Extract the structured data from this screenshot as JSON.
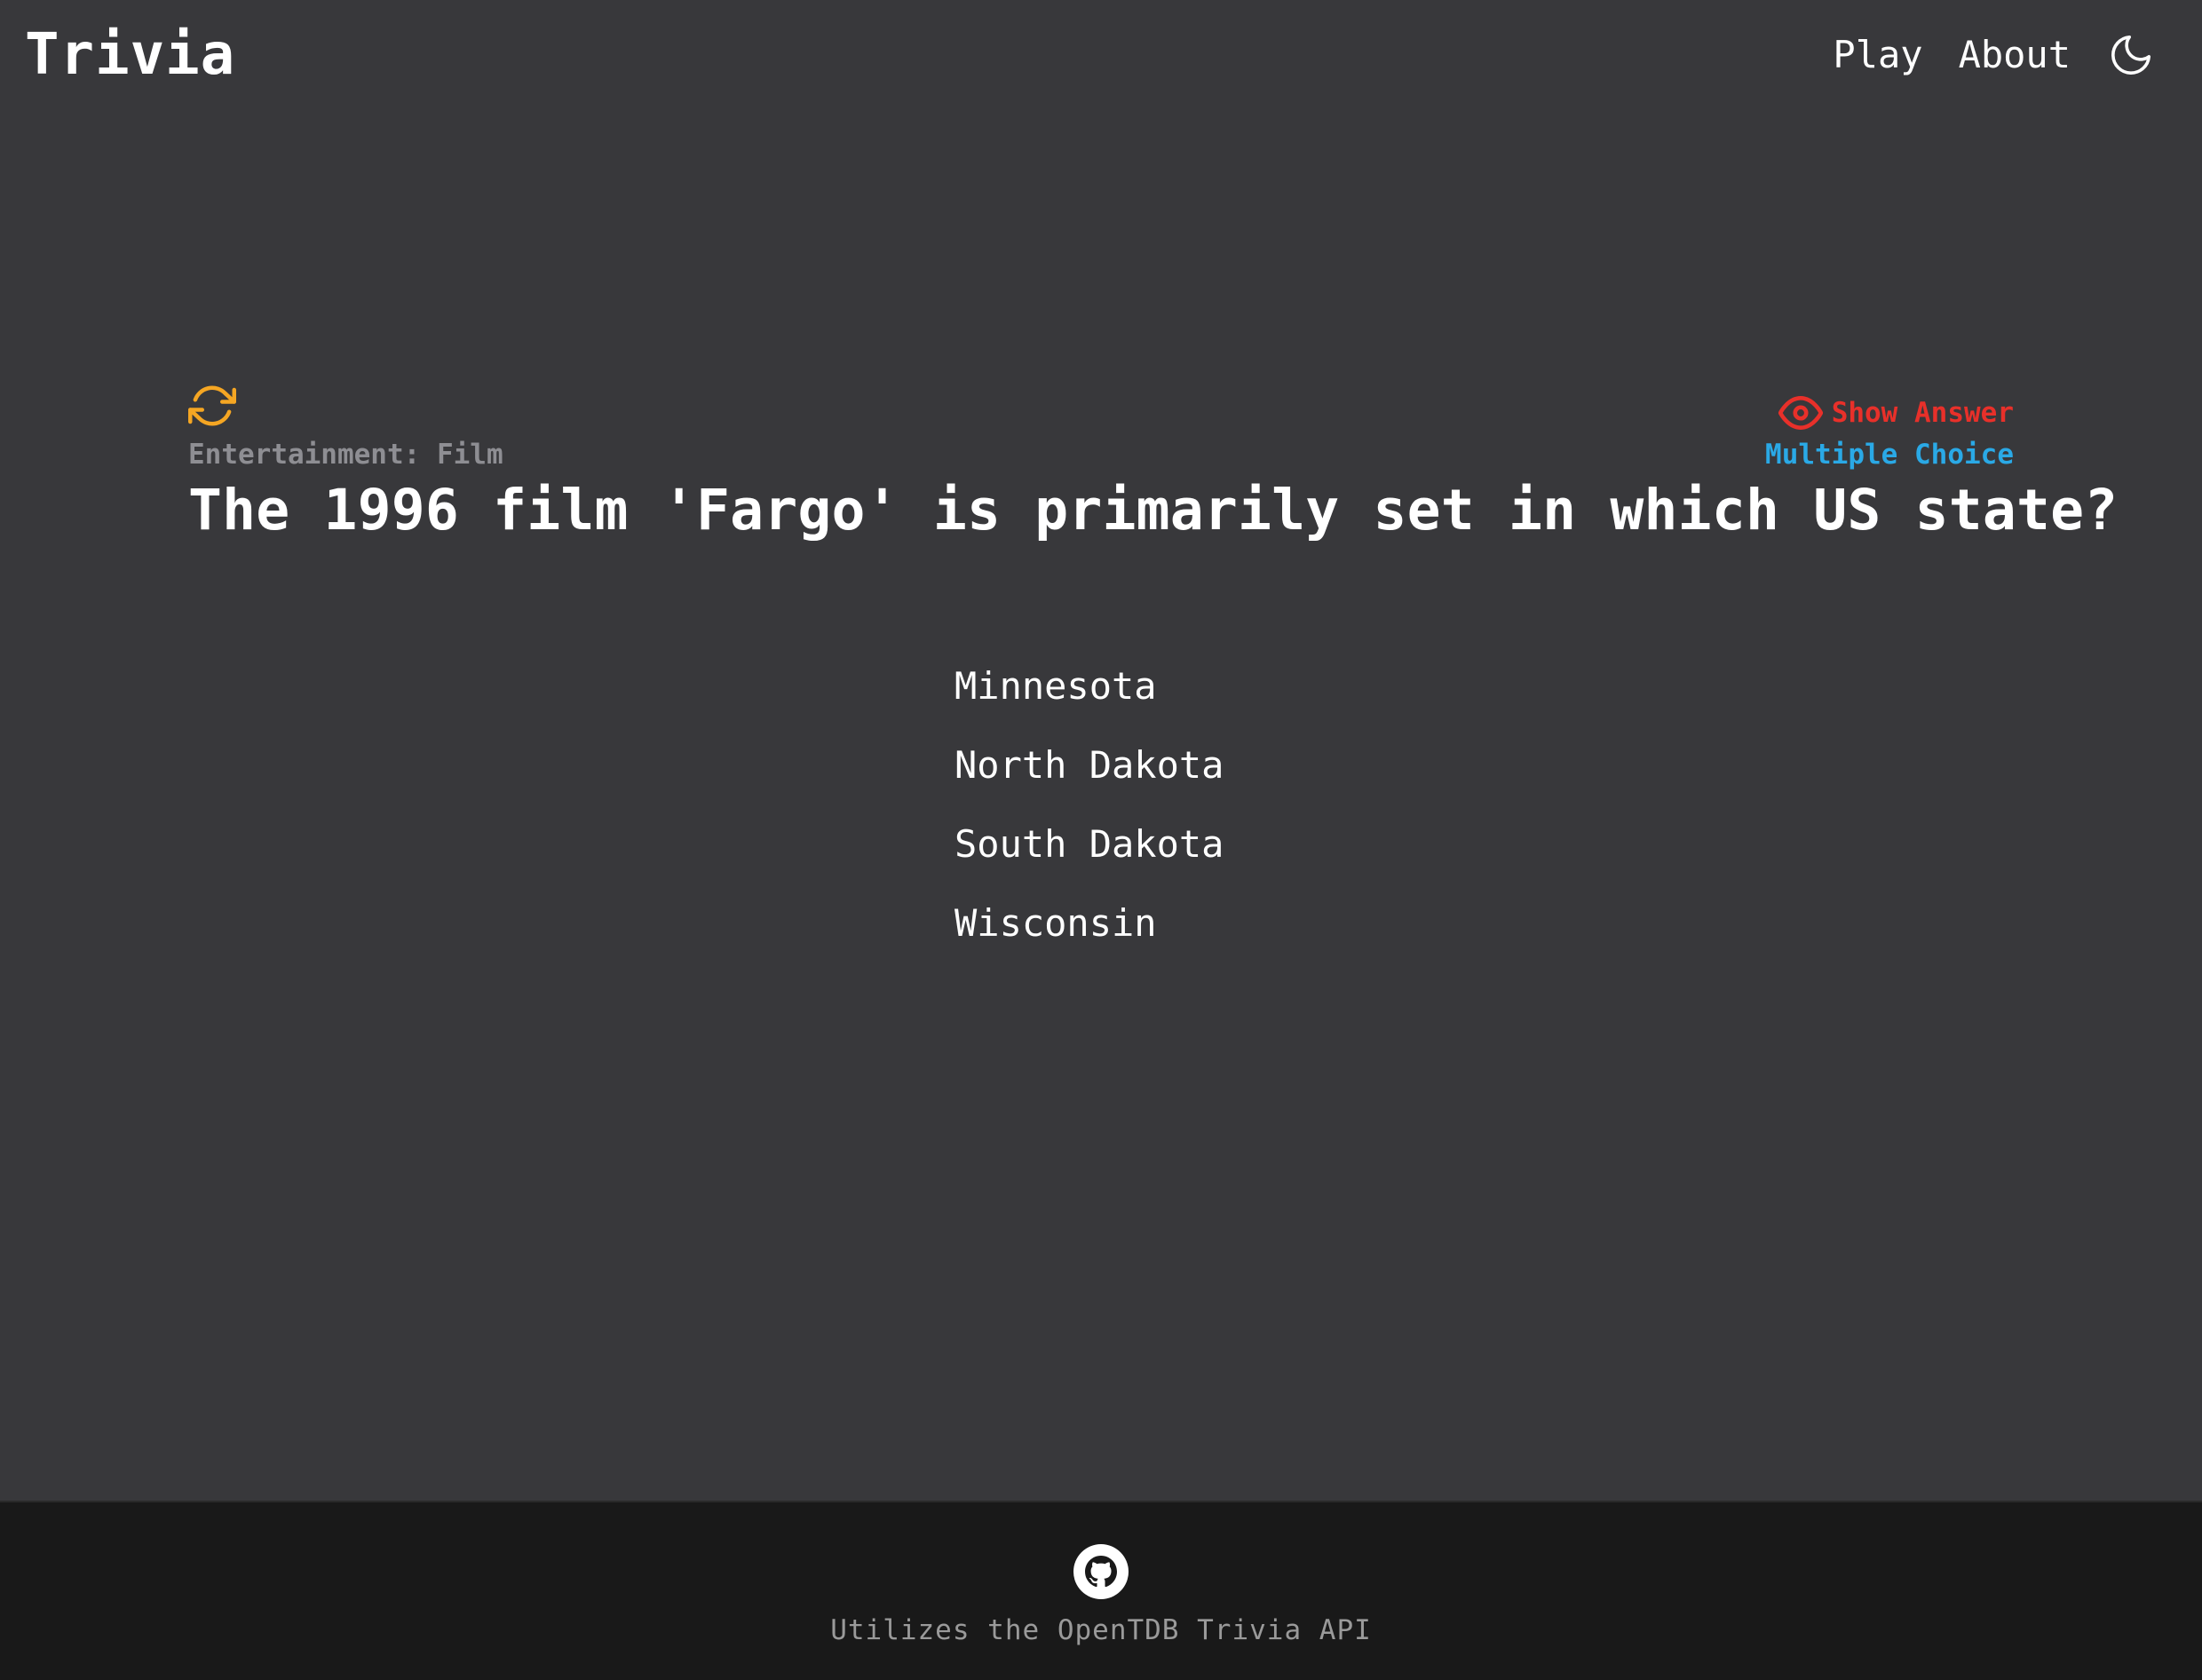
{
  "header": {
    "brand": "Trivia",
    "nav": {
      "play_label": "Play",
      "about_label": "About",
      "theme_icon": "moon-icon"
    }
  },
  "question_card": {
    "refresh_icon": "refresh-icon",
    "category": "Entertainment: Film",
    "show_answer": {
      "icon": "eye-icon",
      "label": "Show Answer"
    },
    "type": "Multiple Choice",
    "question": "The 1996 film 'Fargo' is primarily set in which US state?",
    "answers": [
      "Minnesota",
      "North Dakota",
      "South Dakota",
      "Wisconsin"
    ]
  },
  "footer": {
    "github_icon": "github-icon",
    "credit": "Utilizes the OpenTDB Trivia API"
  },
  "colors": {
    "background": "#38383b",
    "footer_background": "#191919",
    "accent_refresh": "#f5a623",
    "show_answer": "#e8302a",
    "question_type": "#2aa9e6",
    "category": "#8e8e93"
  }
}
